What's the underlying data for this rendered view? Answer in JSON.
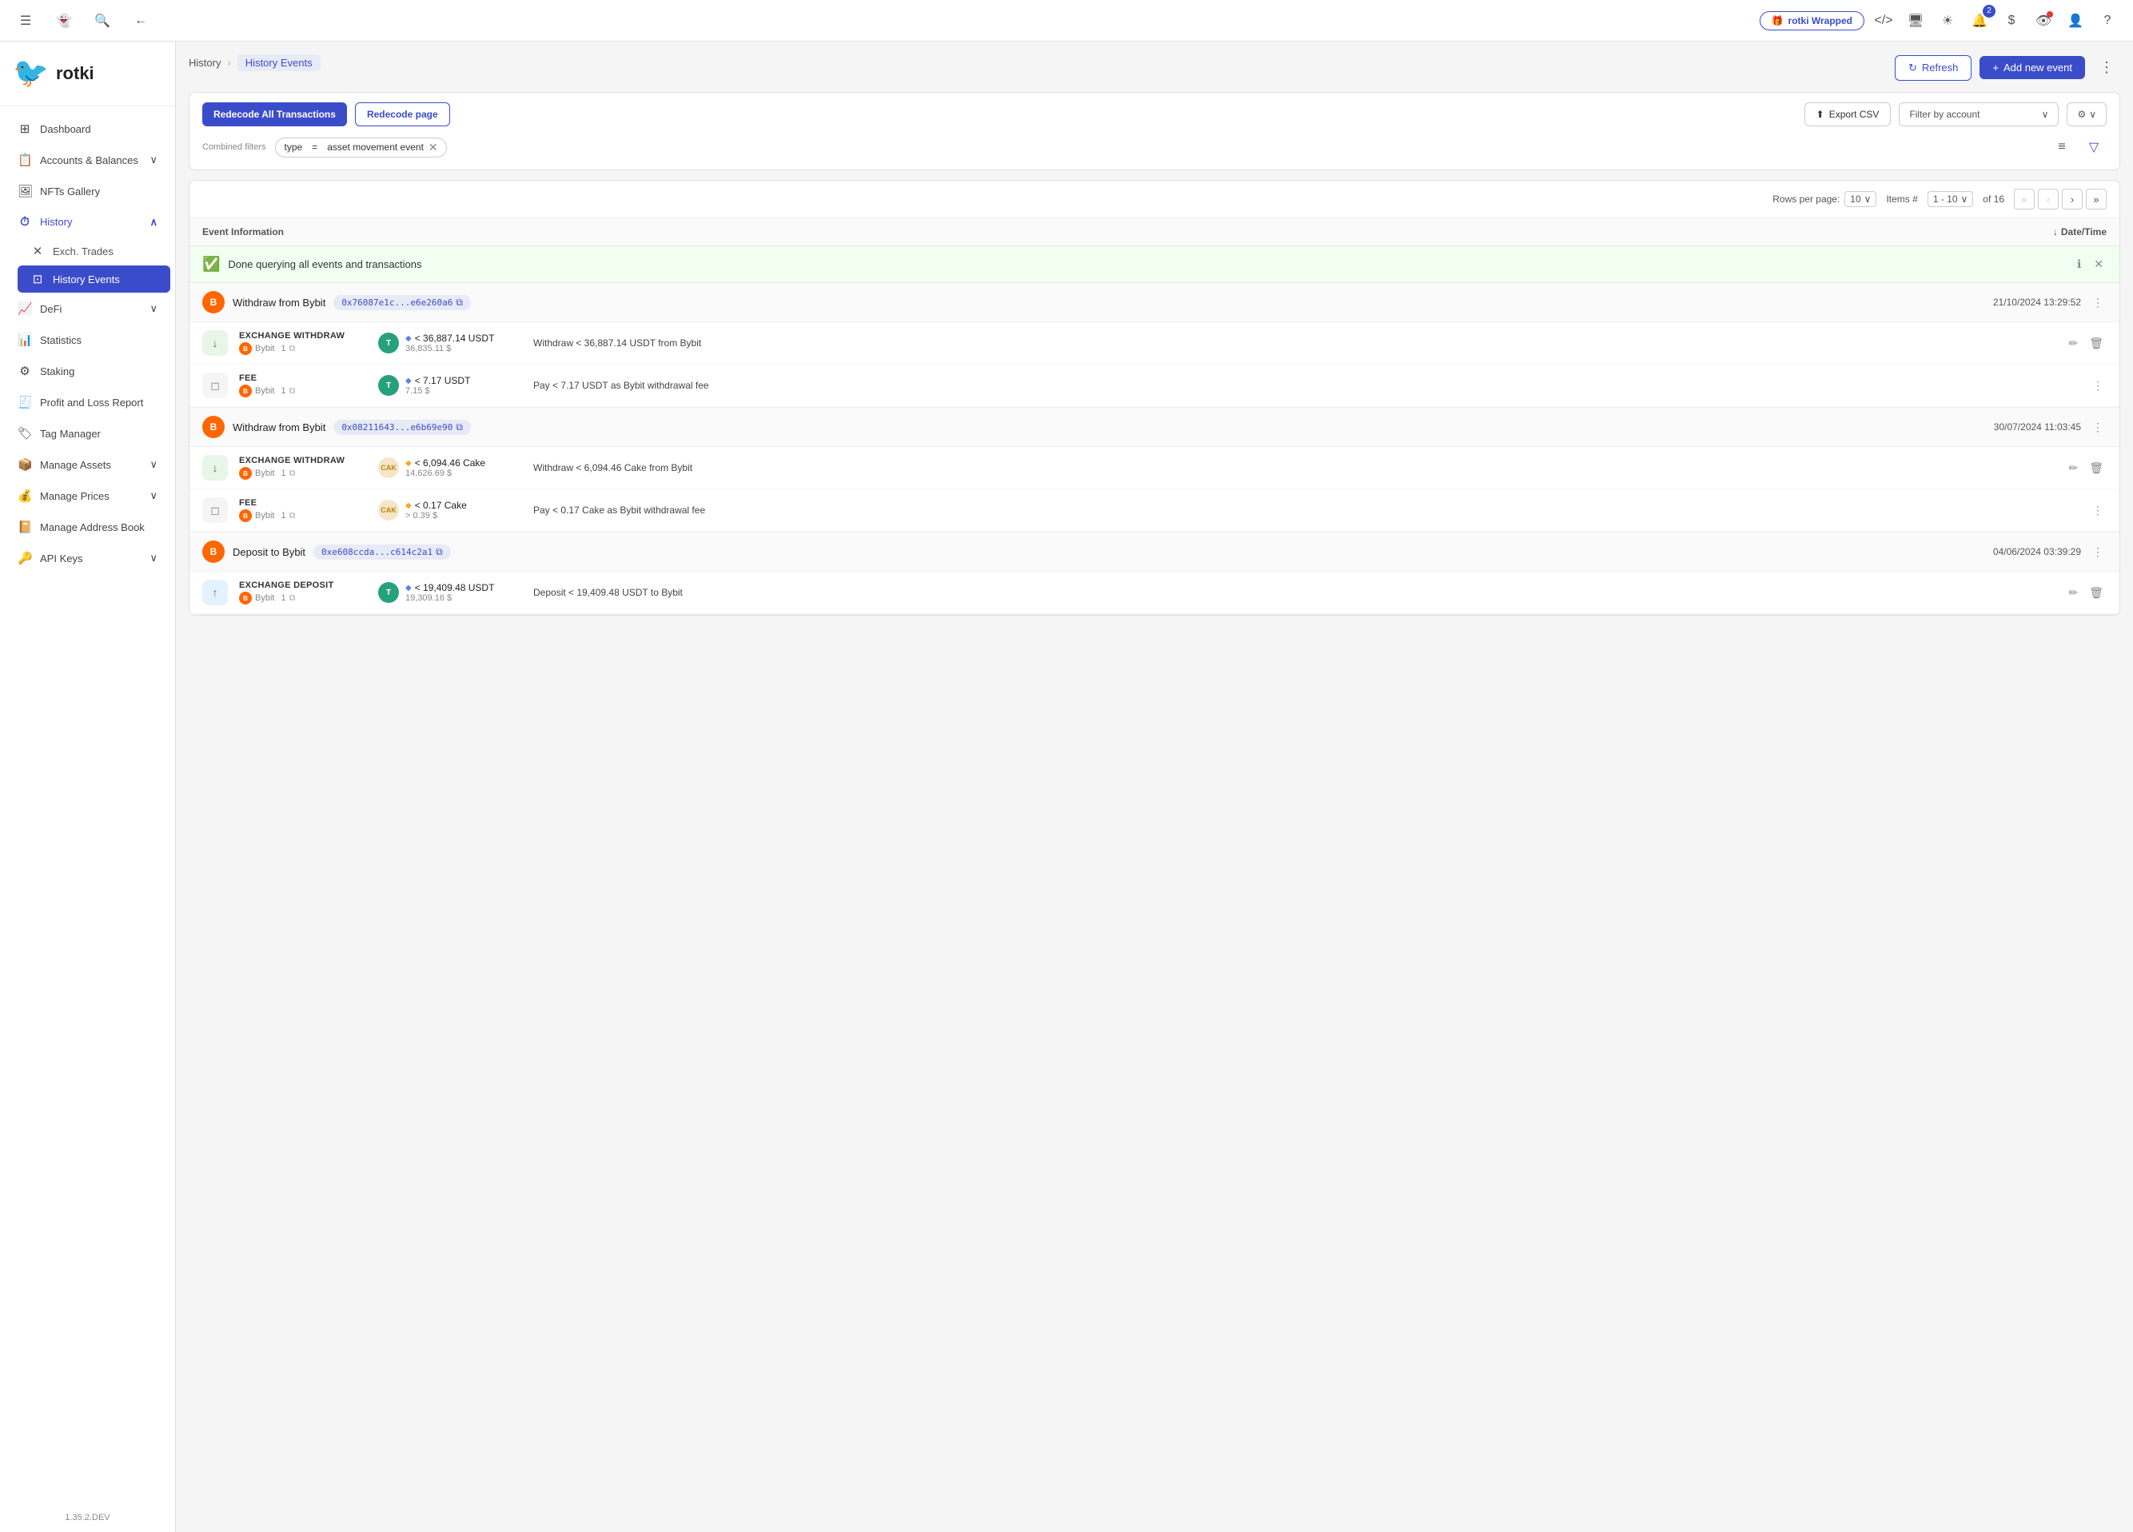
{
  "app": {
    "title": "rotki",
    "version": "1.35.2.DEV"
  },
  "topbar": {
    "wrapped_label": "rotki Wrapped",
    "notification_count": "2"
  },
  "breadcrumb": {
    "parent": "History",
    "current": "History Events"
  },
  "page": {
    "refresh_label": "Refresh",
    "add_event_label": "Add new event"
  },
  "filters": {
    "recode_all_label": "Redecode All Transactions",
    "recode_page_label": "Redecode page",
    "export_csv_label": "Export CSV",
    "filter_account_label": "Filter by account",
    "combined_filters_label": "Combined filters",
    "chip_type": "type",
    "chip_eq": "=",
    "chip_value": "asset movement event"
  },
  "table": {
    "rows_per_page_label": "Rows per page:",
    "rows_per_page_value": "10",
    "items_label": "Items #",
    "items_range": "1 - 10",
    "items_total": "of 16",
    "col_event_info": "Event Information",
    "col_datetime": "Date/Time"
  },
  "status_banner": {
    "message": "Done querying all events and transactions"
  },
  "transactions": [
    {
      "type": "withdraw",
      "label": "Withdraw from Bybit",
      "hash": "0x76087e1c...e6e260a6",
      "datetime": "21/10/2024 13:29:52",
      "events": [
        {
          "event_type": "EXCHANGE WITHDRAW",
          "source": "Bybit",
          "source_num": "1",
          "asset_symbol": "USDT",
          "asset_color": "#26a17b",
          "asset_amount": "< 36,887.14 USDT",
          "asset_usd": "36,835.11 $",
          "description": "Withdraw < 36,887.14 USDT from Bybit",
          "icon": "↓",
          "has_edit": true
        },
        {
          "event_type": "FEE",
          "source": "Bybit",
          "source_num": "1",
          "asset_symbol": "USDT",
          "asset_color": "#26a17b",
          "asset_amount": "< 7.17 USDT",
          "asset_usd": "7.15 $",
          "description": "Pay < 7.17 USDT as Bybit withdrawal fee",
          "icon": "◻",
          "has_edit": false
        }
      ]
    },
    {
      "type": "withdraw",
      "label": "Withdraw from Bybit",
      "hash": "0x08211643...e6b69e90",
      "datetime": "30/07/2024 11:03:45",
      "events": [
        {
          "event_type": "EXCHANGE WITHDRAW",
          "source": "Bybit",
          "source_num": "1",
          "asset_symbol": "CAK",
          "asset_color": "#f5a623",
          "asset_amount": "< 6,094.46 Cake",
          "asset_usd": "14,626.69 $",
          "description": "Withdraw < 6,094.46 Cake from Bybit",
          "icon": "↓",
          "has_edit": true
        },
        {
          "event_type": "FEE",
          "source": "Bybit",
          "source_num": "1",
          "asset_symbol": "CAK",
          "asset_color": "#f5a623",
          "asset_amount": "< 0.17 Cake",
          "asset_usd": "> 0.39 $",
          "description": "Pay < 0.17 Cake as Bybit withdrawal fee",
          "icon": "◻",
          "has_edit": false
        }
      ]
    },
    {
      "type": "deposit",
      "label": "Deposit to Bybit",
      "hash": "0xe608ccda...c614c2a1",
      "datetime": "04/06/2024 03:39:29",
      "events": [
        {
          "event_type": "EXCHANGE DEPOSIT",
          "source": "Bybit",
          "source_num": "1",
          "asset_symbol": "USDT",
          "asset_color": "#26a17b",
          "asset_amount": "< 19,409.48 USDT",
          "asset_usd": "19,309.16 $",
          "description": "Deposit < 19,409.48 USDT to Bybit",
          "icon": "↑",
          "has_edit": true
        }
      ]
    }
  ],
  "sidebar": {
    "items": [
      {
        "id": "dashboard",
        "label": "Dashboard",
        "icon": "⊞",
        "has_sub": false
      },
      {
        "id": "accounts",
        "label": "Accounts & Balances",
        "icon": "⊟",
        "has_sub": true
      },
      {
        "id": "nfts",
        "label": "NFTs Gallery",
        "icon": "⊡",
        "has_sub": false
      },
      {
        "id": "history",
        "label": "History",
        "icon": "⌚",
        "has_sub": true,
        "expanded": true
      },
      {
        "id": "defi",
        "label": "DeFi",
        "icon": "∿",
        "has_sub": true
      },
      {
        "id": "statistics",
        "label": "Statistics",
        "icon": "⊛",
        "has_sub": false
      },
      {
        "id": "staking",
        "label": "Staking",
        "icon": "⊜",
        "has_sub": false
      },
      {
        "id": "pnl",
        "label": "Profit and Loss Report",
        "icon": "⊝",
        "has_sub": false
      },
      {
        "id": "tag-manager",
        "label": "Tag Manager",
        "icon": "⊚",
        "has_sub": false
      },
      {
        "id": "manage-assets",
        "label": "Manage Assets",
        "icon": "⊠",
        "has_sub": true
      },
      {
        "id": "manage-prices",
        "label": "Manage Prices",
        "icon": "⊟",
        "has_sub": true
      },
      {
        "id": "address-book",
        "label": "Manage Address Book",
        "icon": "⊞",
        "has_sub": false
      },
      {
        "id": "api-keys",
        "label": "API Keys",
        "icon": "⌗",
        "has_sub": true
      }
    ],
    "sub_items": [
      {
        "id": "exch-trades",
        "label": "Exch. Trades",
        "icon": "✕"
      },
      {
        "id": "history-events",
        "label": "History Events",
        "icon": "⊡",
        "active": true
      }
    ]
  }
}
